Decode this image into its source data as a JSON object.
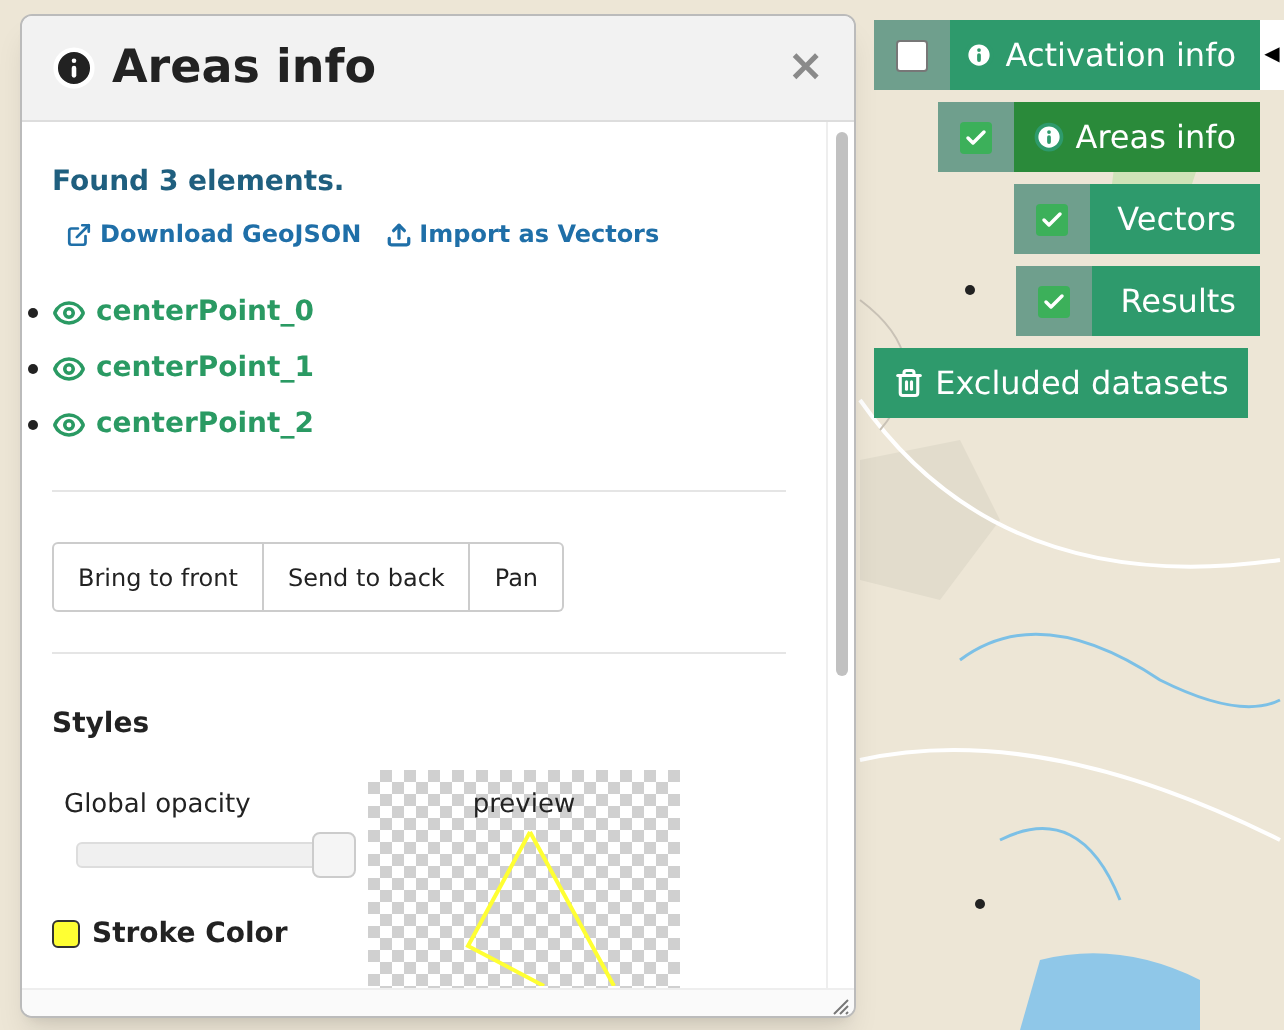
{
  "panel": {
    "title": "Areas info",
    "close": "×",
    "found": "Found 3 elements.",
    "links": [
      {
        "kind": "download",
        "label": "Download GeoJSON"
      },
      {
        "kind": "import",
        "label": "Import as Vectors"
      }
    ],
    "elements": [
      {
        "label": "centerPoint_0"
      },
      {
        "label": "centerPoint_1"
      },
      {
        "label": "centerPoint_2"
      }
    ],
    "actions": [
      "Bring to front",
      "Send to back",
      "Pan"
    ],
    "styles": {
      "heading": "Styles",
      "opacity": {
        "label": "Global opacity",
        "level": 1
      },
      "stroke": {
        "label": "Stroke Color",
        "color": "#ffff33"
      },
      "preview": "preview"
    }
  },
  "layers": [
    {
      "label": "Activation info",
      "kind": "info",
      "checked": false,
      "selected": false
    },
    {
      "label": "Areas info",
      "kind": "info",
      "checked": true,
      "selected": true
    },
    {
      "label": "Vectors",
      "kind": "plain",
      "checked": true,
      "selected": false
    },
    {
      "label": "Results",
      "kind": "plain",
      "checked": true,
      "selected": false
    }
  ],
  "excluded": {
    "label": "Excluded datasets"
  },
  "collapse": "◀"
}
